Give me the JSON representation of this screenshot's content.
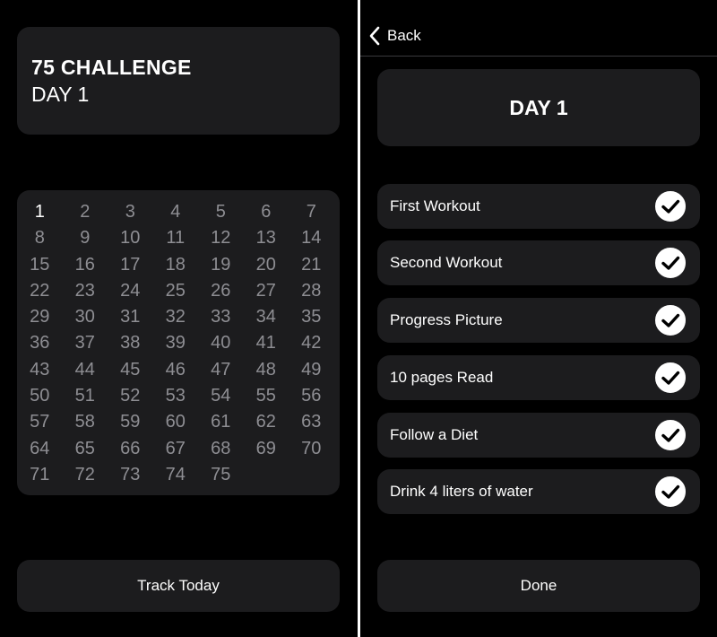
{
  "left": {
    "header": {
      "title": "75 CHALLENGE",
      "subtitle": "DAY 1"
    },
    "calendar": {
      "total_days": 75,
      "current_day": 1
    },
    "track_button": "Track Today"
  },
  "right": {
    "nav": {
      "back_label": "Back"
    },
    "day_title": "DAY 1",
    "tasks": [
      {
        "label": "First Workout",
        "checked": true
      },
      {
        "label": "Second Workout",
        "checked": true
      },
      {
        "label": "Progress Picture",
        "checked": true
      },
      {
        "label": "10 pages Read",
        "checked": true
      },
      {
        "label": "Follow a Diet",
        "checked": true
      },
      {
        "label": "Drink 4 liters of water",
        "checked": true
      }
    ],
    "done_button": "Done"
  },
  "colors": {
    "background": "#000000",
    "card": "#1c1c1e",
    "muted_text": "#8e8e93",
    "text": "#ffffff"
  },
  "icons": {
    "back": "chevron-left-icon",
    "check": "checkmark-circle-icon"
  }
}
